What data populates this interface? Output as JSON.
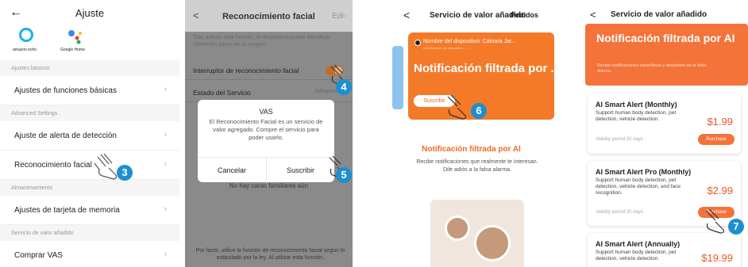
{
  "panel1": {
    "back_icon": "arrow-left",
    "title": "Ajuste",
    "alexa_label": "amazon echo",
    "google_label": "Google Home",
    "sections": [
      {
        "label": "Ajustes básicos"
      },
      {
        "label": "Advanced Settings"
      },
      {
        "label": "Almacenamiento"
      },
      {
        "label": "Servicio de valor añadido"
      }
    ],
    "rows": [
      {
        "label": "Ajustes de funciones básicas"
      },
      {
        "label": "Ajuste de alerta de detección"
      },
      {
        "label": "Reconocimiento facial"
      },
      {
        "label": "Ajustes de tarjeta de memoria"
      },
      {
        "label": "Comprar VAS"
      }
    ],
    "chevron": "›",
    "step": "3"
  },
  "panel2": {
    "back_icon": "chevron-left",
    "title": "Reconocimiento facial",
    "edit": "Edi-",
    "note": "Tras activar esta función, el dispositivo puede identificar diferentes caras en la imagen.",
    "toggle_label": "Interruptor de reconocimiento facial",
    "status_label": "Estado del Servicio",
    "status_value": "Indisponible",
    "no_faces": "No hay caras familiares aún",
    "footer": "Por favor, utilice la función de reconocimiento facial según lo estipulado por la ley. Al utilizar esta función,",
    "dialog": {
      "title": "VAS",
      "message": "El Reconocimiento Facial es un servicio de valor agregado. Compre el servicio para poder usarlo.",
      "cancel": "Cancelar",
      "subscribe": "Suscribir"
    },
    "step_toggle": "4",
    "step_subscribe": "5"
  },
  "panel3": {
    "back_icon": "chevron-left",
    "title": "Servicio de valor añadido",
    "orders": "Pedidos",
    "device_name": "Nombre del dispositivo: Cámara Jar...",
    "device_id": "Identificación del dispositivo: .......",
    "banner_title": "Notificación filtrada por ...",
    "subscribe": "Suscribir",
    "heading": "Notificación filtrada por AI",
    "desc": "Recibe notificaciones que realmente te interesan. Dile adiós a la falsa alarma.",
    "step": "6"
  },
  "panel4": {
    "back_icon": "chevron-left",
    "title": "Servicio de valor añadido",
    "banner_title": "Notificación filtrada por AI",
    "banner_sub": "Recibe notificaciones específicas y despídete de la falsa alarma.",
    "plans": [
      {
        "name": "AI Smart Alert (Monthly)",
        "desc": "Support human body detection, pet detection, vehicle detection.",
        "price": "$1.99",
        "validity": "Validity period:30 days",
        "button": "Purchase"
      },
      {
        "name": "AI Smart Alert Pro (Monthly)",
        "desc": "Support human body detection, pet detection, vehicle detection, and face recognition.",
        "price": "$2.99",
        "validity": "Validity period:30 days",
        "button": "Purchase"
      },
      {
        "name": "AI Smart Alert (Annually)",
        "desc": "Support human body detection, pet detection, vehicle detection.",
        "price": "$19.99"
      }
    ],
    "step": "7"
  },
  "colors": {
    "accent": "#f4733a",
    "badge": "#1d8fd0",
    "price": "#e85a24"
  }
}
